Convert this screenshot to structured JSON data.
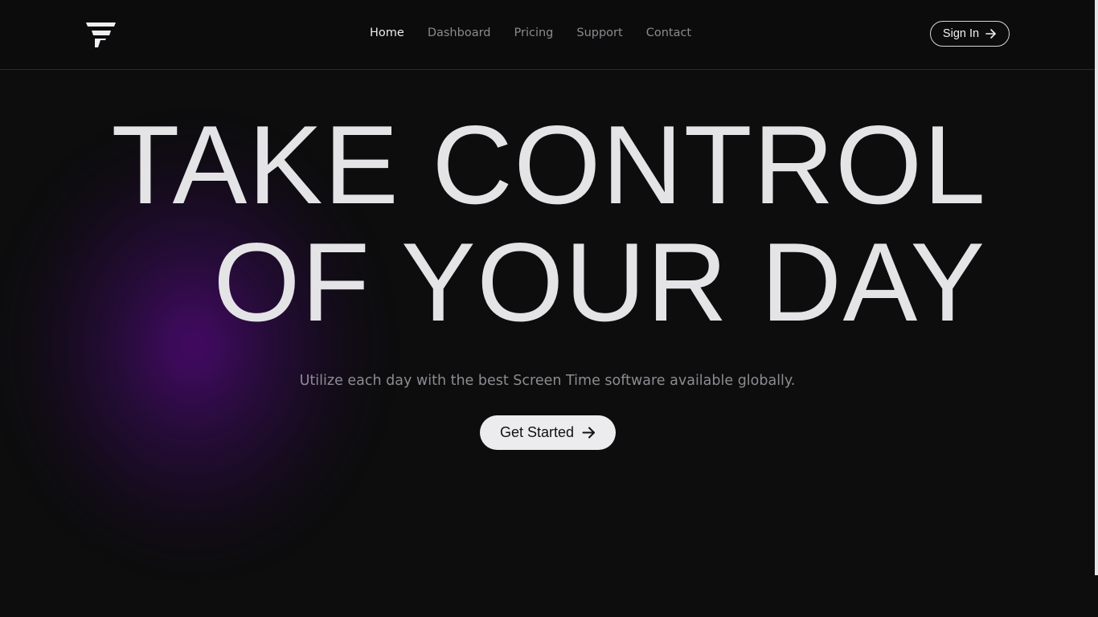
{
  "nav": {
    "logo_icon": "stacked-bars-logo-icon",
    "links": [
      {
        "label": "Home",
        "active": true
      },
      {
        "label": "Dashboard",
        "active": false
      },
      {
        "label": "Pricing",
        "active": false
      },
      {
        "label": "Support",
        "active": false
      },
      {
        "label": "Contact",
        "active": false
      }
    ],
    "signin": {
      "label": "Sign In",
      "icon": "arrow-right-icon"
    }
  },
  "hero": {
    "headline_line1": "TAKE CONTROL",
    "headline_line2": "OF YOUR DAY",
    "subtitle": "Utilize each day with the best Screen Time software available globally.",
    "cta": {
      "label": "Get Started",
      "icon": "arrow-right-icon"
    }
  },
  "colors": {
    "background": "#0d0d0e",
    "text_primary": "#e4e4e6",
    "text_muted": "#8c8c91",
    "glow": "#4a0a6e",
    "button_bg": "#ececee"
  }
}
